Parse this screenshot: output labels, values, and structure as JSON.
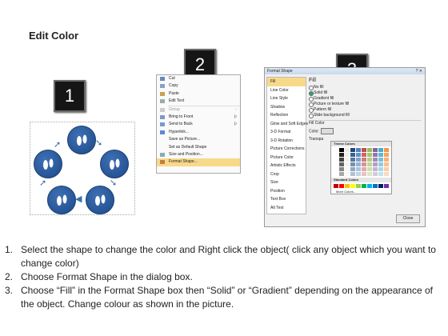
{
  "title": "Edit Color",
  "badges": [
    "1",
    "2",
    "3"
  ],
  "menu": {
    "items": [
      {
        "label": "Cut",
        "sub": ""
      },
      {
        "label": "Copy",
        "sub": ""
      },
      {
        "label": "Paste",
        "sub": ""
      },
      {
        "label": "Edit Text",
        "sub": ""
      },
      {
        "label": "Group",
        "sub": "›"
      },
      {
        "label": "Bring to Front",
        "sub": "|›"
      },
      {
        "label": "Send to Back",
        "sub": "|›"
      },
      {
        "label": "Hyperlink...",
        "sub": ""
      },
      {
        "label": "Save as Picture...",
        "sub": ""
      },
      {
        "label": "Set as Default Shape",
        "sub": ""
      },
      {
        "label": "Size and Position...",
        "sub": ""
      },
      {
        "label": "Format Shape...",
        "sub": ""
      }
    ]
  },
  "dialog": {
    "title": "Format Shape",
    "nav": [
      "Fill",
      "Line Color",
      "Line Style",
      "Shadow",
      "Reflection",
      "Glow and Soft Edges",
      "3-D Format",
      "3-D Rotation",
      "Picture Corrections",
      "Picture Color",
      "Artistic Effects",
      "Crop",
      "Size",
      "Position",
      "Text Box",
      "Alt Text"
    ],
    "fill_heading": "Fill",
    "options": [
      "No fill",
      "Solid fill",
      "Gradient fill",
      "Picture or texture fill",
      "Pattern fill",
      "Slide background fill"
    ],
    "fill_color_label": "Fill Color",
    "color_label": "Color:",
    "transparency_label": "Transpa",
    "theme_colors": "Theme Colors",
    "standard_colors": "Standard Colors",
    "more_colors": "More Colors...",
    "close": "Close"
  },
  "steps": [
    {
      "n": "1.",
      "text": "Select the shape to change the color and Right click the object( click any object which you want to change color)"
    },
    {
      "n": "2.",
      "text": "Choose Format Shape in the dialog box."
    },
    {
      "n": "3.",
      "text": "Choose “Fill” in the Format Shape box then “Solid” or “Gradient” depending on the appearance of the object. Change colour as shown in the picture."
    }
  ]
}
